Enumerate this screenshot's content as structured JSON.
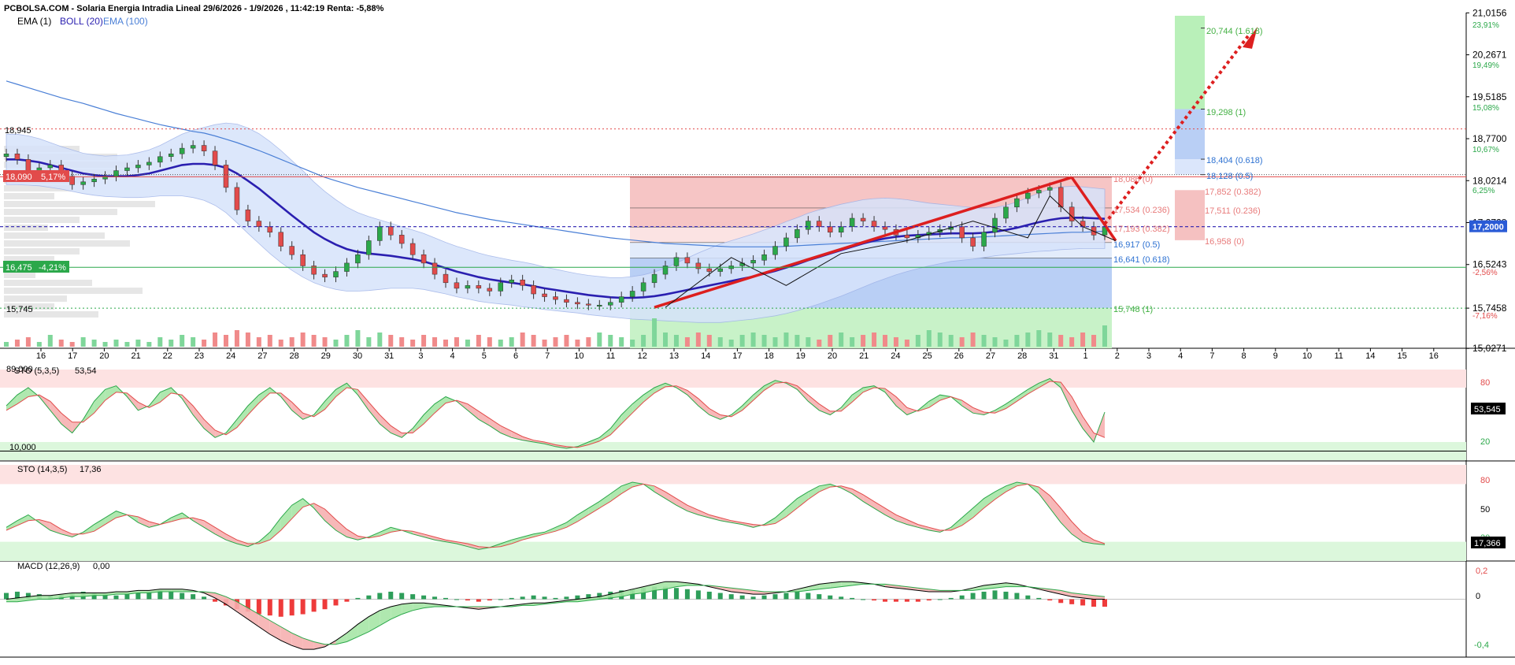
{
  "header": {
    "title": "PCBOLSA.COM - Solaria Energia Intradia Lineal 29/6/2026 - 1/9/2026 , 11:42:19 Renta: -5,88%",
    "indicators": [
      {
        "label": "EMA (1)",
        "color": "#000000"
      },
      {
        "label": "BOLL (20)",
        "color": "#2a1fb0"
      },
      {
        "label": "EMA (100)",
        "color": "#4a7fd6"
      }
    ]
  },
  "colors": {
    "up": "#2ba84a",
    "down": "#e24b4b",
    "boll": "#2a1fb0",
    "boll_band": "#d7e3fb",
    "ema100": "#4a7fd6",
    "trend": "#dd1f1f",
    "fib_green": "#43b043",
    "fib_blue": "#2e72d2",
    "fib_red": "#e24b4b"
  },
  "price_axis": {
    "ticks": [
      "21,0156",
      "20,2671",
      "19,5185",
      "18,7700",
      "18,0214",
      "17,2728",
      "16,5243",
      "15,7458",
      "15,0271"
    ],
    "pct_ticks": [
      "23,91%",
      "19,49%",
      "15,08%",
      "10,67%",
      "6,25%",
      "-2,56%",
      "-7,16%"
    ],
    "current": "17,2000"
  },
  "left_labels": {
    "high": "18,945",
    "prev": "18,090",
    "prev_pct": "5,17%",
    "mid": "16,475",
    "mid_pct": "-4,21%",
    "low": "15,745"
  },
  "x_axis": {
    "dates": [
      "16",
      "17",
      "20",
      "21",
      "22",
      "23",
      "24",
      "27",
      "28",
      "29",
      "30",
      "31",
      "3",
      "4",
      "5",
      "6",
      "7",
      "10",
      "11",
      "12",
      "13",
      "14",
      "17",
      "18",
      "19",
      "20",
      "21",
      "24",
      "25",
      "26",
      "27",
      "28",
      "31",
      "1",
      "2",
      "3",
      "4",
      "7",
      "8",
      "9",
      "10",
      "11",
      "14",
      "15",
      "16"
    ]
  },
  "fib_levels": {
    "projection": [
      "20,744 (1.618)",
      "19,298 (1)",
      "18,404 (0.618)",
      "18,128 (0.5)"
    ],
    "retracement": [
      "18,086 (0)",
      "17,534 (0.236)",
      "17,193 (0.382)",
      "16,917 (0.5)",
      "16,641 (0.618)",
      "15,748 (1)"
    ],
    "extension": [
      "17,852 (0.382)",
      "17,511 (0.236)",
      "16,958 (0)"
    ]
  },
  "sto1": {
    "label": "STO (5,3,5)",
    "value": "53,54",
    "prefix": "89,000",
    "level_label": "10,000",
    "axis": [
      "80",
      "20"
    ],
    "current": "53,545"
  },
  "sto2": {
    "label": "STO (14,3,5)",
    "value": "17,36",
    "axis": [
      "80",
      "50",
      "20"
    ],
    "current": "17,366"
  },
  "macd": {
    "label": "MACD (12,26,9)",
    "value": "0,00",
    "axis": [
      "0,2",
      "0",
      "-0,4"
    ]
  },
  "chart_data": {
    "type": "candlestick",
    "title": "PCBOLSA.COM - Solaria Energia Intradia Lineal 29/6/2026 - 1/9/2026 , 11:42:19 Renta: -5,88%",
    "ylim": [
      15.03,
      21.02
    ],
    "close": [
      18.5,
      18.4,
      18.2,
      18.25,
      18.3,
      18.1,
      17.95,
      18.0,
      18.05,
      18.1,
      18.2,
      18.25,
      18.3,
      18.35,
      18.45,
      18.5,
      18.6,
      18.65,
      18.55,
      18.3,
      17.9,
      17.5,
      17.3,
      17.2,
      17.1,
      16.85,
      16.7,
      16.5,
      16.35,
      16.3,
      16.4,
      16.55,
      16.7,
      16.95,
      17.2,
      17.05,
      16.9,
      16.7,
      16.55,
      16.35,
      16.2,
      16.1,
      16.15,
      16.1,
      16.05,
      16.2,
      16.25,
      16.15,
      16.0,
      15.95,
      15.9,
      15.85,
      15.82,
      15.8,
      15.8,
      15.85,
      15.95,
      16.05,
      16.2,
      16.35,
      16.5,
      16.65,
      16.55,
      16.45,
      16.4,
      16.45,
      16.5,
      16.55,
      16.6,
      16.7,
      16.85,
      17.0,
      17.15,
      17.3,
      17.2,
      17.1,
      17.2,
      17.35,
      17.3,
      17.2,
      17.15,
      17.05,
      17.0,
      17.05,
      17.1,
      17.15,
      17.2,
      17.0,
      16.85,
      17.1,
      17.35,
      17.55,
      17.7,
      17.8,
      17.85,
      17.9,
      17.55,
      17.3,
      17.2,
      17.05,
      17.2
    ],
    "ema100": [
      19.8,
      19.74,
      19.68,
      19.62,
      19.56,
      19.5,
      19.45,
      19.4,
      19.34,
      19.28,
      19.22,
      19.17,
      19.12,
      19.07,
      19.02,
      18.98,
      18.94,
      18.9,
      18.87,
      18.82,
      18.76,
      18.7,
      18.63,
      18.56,
      18.48,
      18.4,
      18.32,
      18.24,
      18.16,
      18.08,
      18.02,
      17.96,
      17.9,
      17.85,
      17.8,
      17.75,
      17.7,
      17.65,
      17.6,
      17.55,
      17.5,
      17.45,
      17.41,
      17.37,
      17.33,
      17.3,
      17.27,
      17.24,
      17.21,
      17.18,
      17.15,
      17.12,
      17.09,
      17.06,
      17.03,
      17.0,
      16.98,
      16.96,
      16.94,
      16.92,
      16.9,
      16.89,
      16.88,
      16.87,
      16.86,
      16.85,
      16.84,
      16.84,
      16.84,
      16.84,
      16.84,
      16.85,
      16.86,
      16.87,
      16.88,
      16.89,
      16.9,
      16.91,
      16.92,
      16.93,
      16.94,
      16.95,
      16.96,
      16.97,
      16.98,
      16.99,
      17.0,
      17.0,
      17.01,
      17.02,
      17.03,
      17.04,
      17.05,
      17.06,
      17.07,
      17.08,
      17.09,
      17.1,
      17.1,
      17.11,
      17.12
    ],
    "boll": [
      18.4,
      18.4,
      18.38,
      18.35,
      18.3,
      18.25,
      18.2,
      18.15,
      18.12,
      18.1,
      18.1,
      18.1,
      18.12,
      18.15,
      18.2,
      18.25,
      18.3,
      18.32,
      18.32,
      18.3,
      18.25,
      18.15,
      18.02,
      17.88,
      17.72,
      17.56,
      17.4,
      17.25,
      17.1,
      16.98,
      16.88,
      16.8,
      16.75,
      16.72,
      16.7,
      16.68,
      16.65,
      16.62,
      16.58,
      16.52,
      16.46,
      16.4,
      16.35,
      16.3,
      16.26,
      16.23,
      16.2,
      16.17,
      16.14,
      16.1,
      16.07,
      16.04,
      16.01,
      15.98,
      15.96,
      15.94,
      15.93,
      15.93,
      15.94,
      15.96,
      15.99,
      16.03,
      16.07,
      16.11,
      16.15,
      16.19,
      16.23,
      16.27,
      16.31,
      16.36,
      16.41,
      16.47,
      16.53,
      16.6,
      16.66,
      16.72,
      16.78,
      16.84,
      16.9,
      16.95,
      16.99,
      17.02,
      17.04,
      17.05,
      17.06,
      17.07,
      17.08,
      17.08,
      17.08,
      17.09,
      17.11,
      17.14,
      17.18,
      17.23,
      17.28,
      17.32,
      17.35,
      17.36,
      17.36,
      17.35,
      17.34
    ],
    "boll_width": [
      0.45,
      0.45,
      0.44,
      0.42,
      0.4,
      0.38,
      0.37,
      0.36,
      0.36,
      0.36,
      0.37,
      0.38,
      0.4,
      0.42,
      0.45,
      0.5,
      0.55,
      0.6,
      0.65,
      0.72,
      0.8,
      0.88,
      0.94,
      0.98,
      1.0,
      1.0,
      0.98,
      0.95,
      0.9,
      0.85,
      0.8,
      0.75,
      0.7,
      0.66,
      0.62,
      0.58,
      0.55,
      0.52,
      0.5,
      0.48,
      0.46,
      0.45,
      0.44,
      0.43,
      0.42,
      0.41,
      0.4,
      0.4,
      0.39,
      0.38,
      0.37,
      0.36,
      0.35,
      0.35,
      0.35,
      0.35,
      0.36,
      0.38,
      0.4,
      0.43,
      0.47,
      0.52,
      0.57,
      0.62,
      0.66,
      0.7,
      0.72,
      0.74,
      0.76,
      0.78,
      0.8,
      0.82,
      0.83,
      0.84,
      0.84,
      0.83,
      0.82,
      0.8,
      0.78,
      0.75,
      0.72,
      0.68,
      0.64,
      0.6,
      0.56,
      0.53,
      0.5,
      0.48,
      0.46,
      0.44,
      0.43,
      0.44,
      0.46,
      0.49,
      0.52,
      0.55,
      0.56,
      0.56,
      0.55,
      0.54,
      0.53
    ],
    "volume": [
      2,
      3,
      4,
      2,
      5,
      3,
      2,
      4,
      3,
      2,
      3,
      2,
      3,
      2,
      4,
      3,
      5,
      4,
      3,
      6,
      5,
      7,
      6,
      4,
      5,
      3,
      4,
      6,
      5,
      4,
      3,
      5,
      7,
      4,
      6,
      5,
      4,
      3,
      5,
      4,
      3,
      4,
      3,
      5,
      4,
      3,
      4,
      6,
      5,
      3,
      4,
      5,
      3,
      4,
      6,
      5,
      4,
      3,
      5,
      12,
      6,
      5,
      4,
      6,
      5,
      4,
      3,
      5,
      6,
      5,
      4,
      6,
      5,
      4,
      3,
      5,
      6,
      4,
      5,
      6,
      5,
      4,
      3,
      5,
      7,
      6,
      5,
      4,
      6,
      5,
      4,
      3,
      5,
      6,
      7,
      6,
      5,
      4,
      6,
      5,
      9
    ],
    "trend_lines": [
      {
        "from": [
          59,
          15.76
        ],
        "to": [
          97,
          18.08
        ]
      },
      {
        "from": [
          97,
          18.08
        ],
        "to": [
          101,
          16.95
        ]
      }
    ],
    "fib_projection": [
      20.744,
      19.298,
      18.404,
      18.128
    ],
    "fib_retracement": [
      18.086,
      17.534,
      17.193,
      16.917,
      16.641,
      15.748
    ],
    "fib_extension": [
      17.852,
      17.511,
      16.958
    ],
    "horizontal_levels": [
      18.945,
      18.09,
      16.475,
      15.745,
      17.2
    ],
    "sto1_k": [
      60,
      72,
      80,
      70,
      55,
      40,
      30,
      45,
      65,
      78,
      82,
      70,
      55,
      60,
      75,
      80,
      68,
      50,
      35,
      25,
      30,
      45,
      60,
      72,
      80,
      70,
      55,
      45,
      50,
      65,
      78,
      85,
      72,
      55,
      40,
      30,
      25,
      35,
      50,
      62,
      70,
      65,
      55,
      45,
      38,
      30,
      25,
      22,
      20,
      18,
      15,
      13,
      15,
      20,
      25,
      35,
      50,
      62,
      72,
      80,
      85,
      80,
      72,
      60,
      50,
      45,
      50,
      60,
      72,
      82,
      88,
      85,
      78,
      65,
      55,
      50,
      58,
      72,
      80,
      82,
      75,
      60,
      50,
      55,
      65,
      72,
      70,
      60,
      52,
      50,
      55,
      62,
      70,
      78,
      85,
      90,
      80,
      55,
      35,
      20,
      53
    ],
    "sto1_d": [
      55,
      62,
      70,
      72,
      65,
      52,
      42,
      42,
      52,
      66,
      75,
      74,
      64,
      58,
      64,
      74,
      72,
      60,
      45,
      33,
      28,
      36,
      50,
      63,
      74,
      74,
      64,
      52,
      48,
      56,
      70,
      80,
      78,
      64,
      50,
      38,
      30,
      30,
      40,
      52,
      63,
      66,
      62,
      54,
      46,
      38,
      32,
      26,
      22,
      20,
      17,
      15,
      14,
      17,
      21,
      28,
      40,
      52,
      64,
      74,
      81,
      82,
      77,
      68,
      57,
      50,
      48,
      55,
      66,
      77,
      85,
      86,
      82,
      72,
      62,
      54,
      54,
      64,
      75,
      80,
      79,
      70,
      58,
      54,
      58,
      66,
      70,
      66,
      58,
      53,
      52,
      57,
      65,
      73,
      80,
      87,
      86,
      70,
      48,
      30,
      25
    ],
    "sto2_k": [
      35,
      42,
      48,
      40,
      32,
      28,
      25,
      30,
      38,
      45,
      52,
      48,
      40,
      35,
      38,
      45,
      50,
      42,
      35,
      28,
      22,
      18,
      15,
      20,
      30,
      45,
      58,
      65,
      55,
      42,
      32,
      25,
      22,
      25,
      30,
      35,
      32,
      28,
      25,
      22,
      20,
      18,
      15,
      12,
      14,
      18,
      22,
      25,
      28,
      30,
      35,
      40,
      48,
      55,
      62,
      70,
      78,
      82,
      80,
      72,
      65,
      58,
      52,
      48,
      45,
      42,
      40,
      38,
      35,
      38,
      45,
      55,
      65,
      72,
      78,
      80,
      76,
      70,
      62,
      55,
      48,
      42,
      38,
      35,
      32,
      30,
      35,
      45,
      55,
      65,
      72,
      78,
      82,
      80,
      70,
      55,
      40,
      28,
      20,
      18,
      17
    ],
    "sto2_d": [
      32,
      37,
      42,
      43,
      40,
      33,
      28,
      28,
      31,
      38,
      45,
      48,
      46,
      41,
      38,
      41,
      44,
      45,
      42,
      35,
      28,
      22,
      18,
      18,
      22,
      32,
      44,
      56,
      60,
      54,
      43,
      33,
      26,
      24,
      26,
      30,
      32,
      31,
      28,
      25,
      22,
      20,
      18,
      15,
      14,
      15,
      18,
      22,
      25,
      28,
      31,
      35,
      41,
      48,
      55,
      62,
      70,
      77,
      80,
      78,
      72,
      65,
      58,
      53,
      48,
      45,
      42,
      40,
      38,
      37,
      39,
      46,
      55,
      64,
      72,
      77,
      78,
      75,
      69,
      62,
      55,
      48,
      43,
      38,
      35,
      32,
      32,
      37,
      45,
      55,
      64,
      72,
      78,
      80,
      77,
      68,
      55,
      41,
      29,
      22,
      18
    ],
    "macd_hist": [
      0.05,
      0.06,
      0.05,
      0.04,
      0.03,
      0.04,
      0.05,
      0.06,
      0.05,
      0.04,
      0.03,
      0.04,
      0.05,
      0.06,
      0.07,
      0.06,
      0.05,
      0.04,
      0.02,
      -0.02,
      -0.05,
      -0.08,
      -0.1,
      -0.12,
      -0.13,
      -0.14,
      -0.13,
      -0.12,
      -0.1,
      -0.08,
      -0.05,
      -0.02,
      0.01,
      0.03,
      0.05,
      0.06,
      0.05,
      0.04,
      0.03,
      0.02,
      0.01,
      0.0,
      -0.01,
      -0.02,
      -0.01,
      0.0,
      0.01,
      0.02,
      0.03,
      0.02,
      0.01,
      0.02,
      0.03,
      0.04,
      0.05,
      0.06,
      0.07,
      0.08,
      0.09,
      0.1,
      0.1,
      0.09,
      0.08,
      0.07,
      0.06,
      0.05,
      0.04,
      0.03,
      0.02,
      0.03,
      0.04,
      0.05,
      0.06,
      0.05,
      0.04,
      0.03,
      0.02,
      0.01,
      0.0,
      -0.01,
      -0.02,
      -0.02,
      -0.02,
      -0.02,
      -0.01,
      0.0,
      0.01,
      0.03,
      0.05,
      0.06,
      0.07,
      0.06,
      0.05,
      0.03,
      0.01,
      -0.01,
      -0.03,
      -0.04,
      -0.05,
      -0.06,
      -0.06
    ],
    "macd_line": [
      0.0,
      0.01,
      0.02,
      0.03,
      0.03,
      0.04,
      0.05,
      0.05,
      0.05,
      0.05,
      0.06,
      0.06,
      0.07,
      0.07,
      0.08,
      0.08,
      0.08,
      0.07,
      0.05,
      0.01,
      -0.04,
      -0.1,
      -0.16,
      -0.22,
      -0.28,
      -0.33,
      -0.37,
      -0.4,
      -0.4,
      -0.38,
      -0.33,
      -0.27,
      -0.2,
      -0.14,
      -0.09,
      -0.06,
      -0.04,
      -0.03,
      -0.03,
      -0.04,
      -0.05,
      -0.06,
      -0.07,
      -0.08,
      -0.07,
      -0.06,
      -0.05,
      -0.04,
      -0.03,
      -0.03,
      -0.02,
      -0.01,
      0.0,
      0.01,
      0.02,
      0.04,
      0.06,
      0.08,
      0.1,
      0.12,
      0.14,
      0.14,
      0.13,
      0.12,
      0.1,
      0.08,
      0.06,
      0.05,
      0.04,
      0.04,
      0.05,
      0.06,
      0.08,
      0.1,
      0.12,
      0.13,
      0.14,
      0.14,
      0.13,
      0.12,
      0.1,
      0.09,
      0.08,
      0.07,
      0.06,
      0.06,
      0.06,
      0.07,
      0.09,
      0.11,
      0.12,
      0.13,
      0.12,
      0.1,
      0.08,
      0.06,
      0.04,
      0.02,
      0.01,
      0.0,
      0.0
    ],
    "macd_signal": [
      -0.02,
      -0.02,
      -0.01,
      0.0,
      0.0,
      0.01,
      0.02,
      0.02,
      0.03,
      0.03,
      0.04,
      0.04,
      0.05,
      0.05,
      0.06,
      0.06,
      0.06,
      0.06,
      0.06,
      0.05,
      0.02,
      -0.02,
      -0.07,
      -0.12,
      -0.17,
      -0.22,
      -0.27,
      -0.31,
      -0.34,
      -0.36,
      -0.36,
      -0.34,
      -0.3,
      -0.26,
      -0.21,
      -0.16,
      -0.12,
      -0.09,
      -0.07,
      -0.06,
      -0.06,
      -0.06,
      -0.06,
      -0.06,
      -0.06,
      -0.06,
      -0.06,
      -0.05,
      -0.05,
      -0.04,
      -0.03,
      -0.02,
      -0.02,
      -0.01,
      0.0,
      0.01,
      0.02,
      0.04,
      0.05,
      0.07,
      0.08,
      0.1,
      0.11,
      0.11,
      0.11,
      0.1,
      0.09,
      0.08,
      0.07,
      0.06,
      0.06,
      0.06,
      0.06,
      0.07,
      0.08,
      0.09,
      0.1,
      0.11,
      0.12,
      0.12,
      0.12,
      0.11,
      0.1,
      0.09,
      0.08,
      0.07,
      0.07,
      0.07,
      0.07,
      0.08,
      0.09,
      0.1,
      0.1,
      0.1,
      0.09,
      0.08,
      0.07,
      0.05,
      0.04,
      0.03,
      0.02
    ]
  }
}
